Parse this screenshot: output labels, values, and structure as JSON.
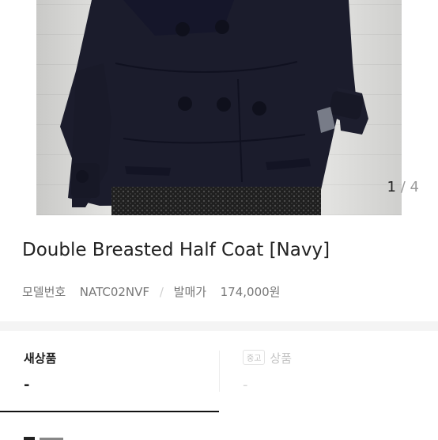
{
  "gallery": {
    "current_page": "1",
    "separator": "/",
    "total_pages": "4"
  },
  "product": {
    "name": "Double Breasted Half Coat [Navy]",
    "model_label": "모델번호",
    "model_number": "NATC02NVF",
    "divider": "/",
    "release_price_label": "발매가",
    "release_price": "174,000원"
  },
  "tabs": {
    "new": {
      "label": "새상품",
      "value": "-"
    },
    "used": {
      "badge": "중고",
      "label": "상품",
      "value": "-"
    }
  },
  "colors": {
    "text": "#222222",
    "muted": "#777777",
    "disabled": "#c4c4c4",
    "coat": "#1b1c2c",
    "active_underline": "#111111"
  }
}
